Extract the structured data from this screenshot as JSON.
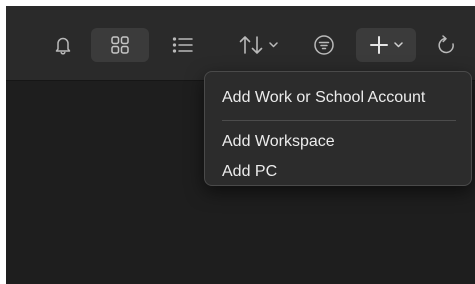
{
  "toolbar": {
    "icons": [
      "bell-icon",
      "grid-view-icon",
      "list-view-icon",
      "sort-icon",
      "chevron-down-icon",
      "filter-icon",
      "plus-icon",
      "refresh-icon"
    ],
    "active_view": "grid"
  },
  "add_menu": {
    "items": [
      {
        "label": "Add Work or School Account"
      },
      {
        "label": "Add Workspace"
      },
      {
        "label": "Add PC"
      }
    ]
  },
  "colors": {
    "window_bg": "#1e1e1e",
    "toolbar_bg": "#2a2a2a",
    "active_button_bg": "#3b3b3b",
    "icon": "#b9b9b9",
    "menu_bg": "#2c2c2c",
    "menu_text": "#ececec"
  }
}
